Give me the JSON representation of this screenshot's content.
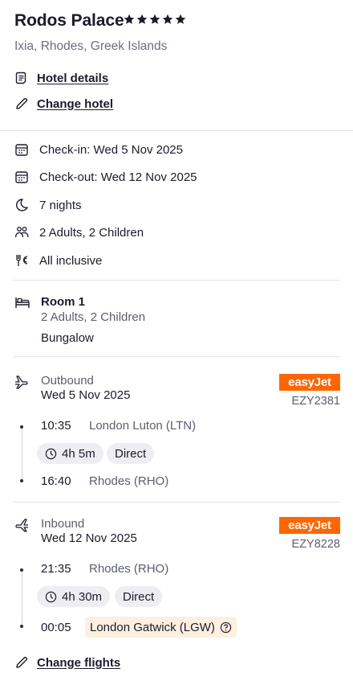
{
  "hotel": {
    "name": "Rodos Palace",
    "stars": 5,
    "location": "Ixia, Rhodes, Greek Islands",
    "details_link": "Hotel details",
    "change_link": "Change hotel"
  },
  "stay": {
    "checkin": "Check-in: Wed 5 Nov 2025",
    "checkout": "Check-out: Wed 12 Nov 2025",
    "nights": "7 nights",
    "guests": "2 Adults, 2 Children",
    "board": "All inclusive"
  },
  "room": {
    "title": "Room 1",
    "guests": "2 Adults, 2 Children",
    "type": "Bungalow"
  },
  "outbound": {
    "label": "Outbound",
    "date": "Wed 5 Nov 2025",
    "airline": "easyJet",
    "flight_no": "EZY2381",
    "dep_time": "10:35",
    "dep_place": "London Luton (LTN)",
    "duration": "4h 5m",
    "stops": "Direct",
    "arr_time": "16:40",
    "arr_place": "Rhodes (RHO)"
  },
  "inbound": {
    "label": "Inbound",
    "date": "Wed 12 Nov 2025",
    "airline": "easyJet",
    "flight_no": "EZY8228",
    "dep_time": "21:35",
    "dep_place": "Rhodes (RHO)",
    "duration": "4h 30m",
    "stops": "Direct",
    "arr_time": "00:05",
    "arr_place": "London Gatwick (LGW)"
  },
  "change_flights": "Change flights",
  "colors": {
    "easyjet_orange": "#ff6600",
    "warn_bg": "#fdf0e0",
    "pill_bg": "#eeeef2"
  }
}
